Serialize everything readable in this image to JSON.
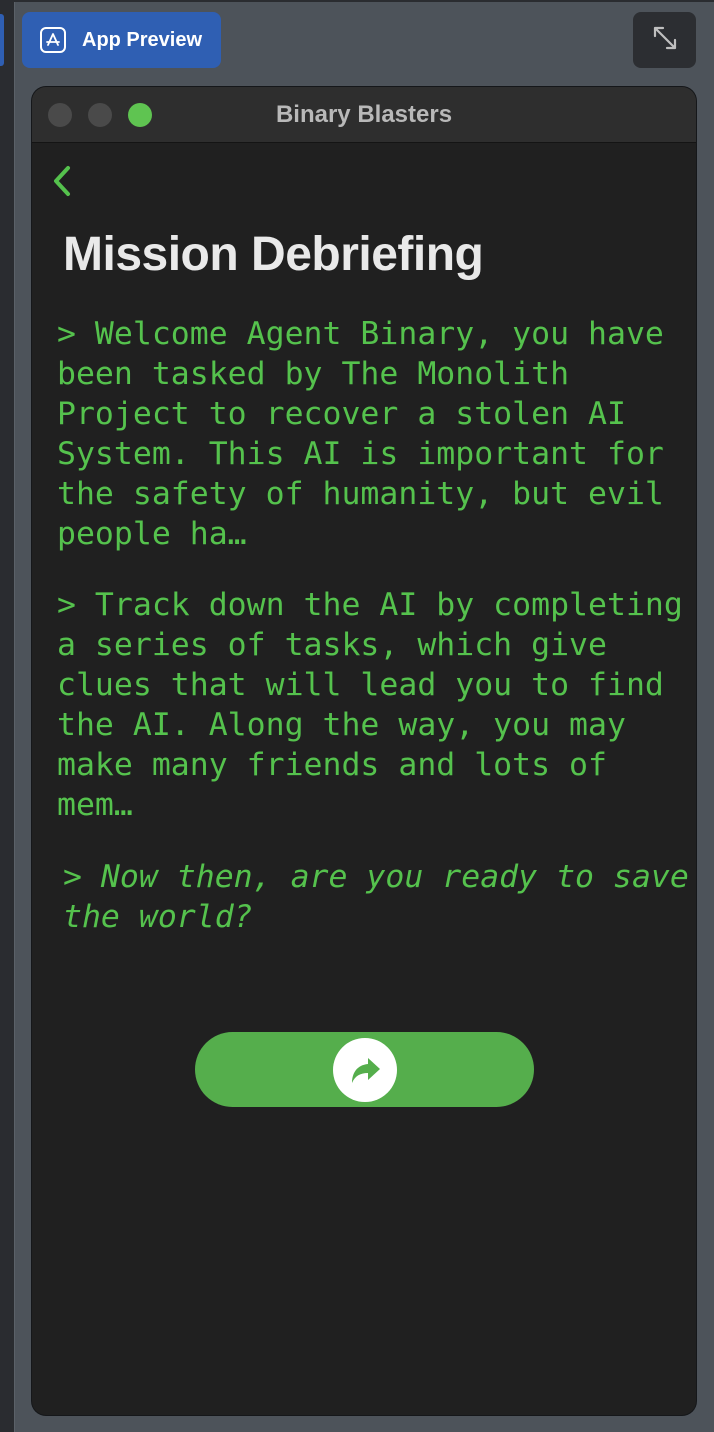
{
  "toolbar": {
    "app_preview_label": "App Preview",
    "app_preview_icon": "app-store-icon",
    "expand_icon": "expand-arrows-icon",
    "accent": "#2f5fb3"
  },
  "window": {
    "title": "Binary Blasters",
    "traffic_light_active": "#5fc451"
  },
  "screen": {
    "back_icon": "chevron-left-icon",
    "title": "Mission Debriefing",
    "paragraphs": [
      "> Welcome Agent Binary, you have been tasked by The Monolith Project to recover a stolen AI System. This AI is important for the safety of humanity, but evil people ha…",
      "> Track down the AI by completing a series of tasks, which give clues that will lead you to find the AI. Along the way, you may make many friends and lots of mem…",
      "> Now then, are you ready to save the world?"
    ],
    "continue_icon": "share-arrow-icon",
    "text_color": "#55c24d",
    "button_color": "#55ae4c",
    "background": "#202020"
  }
}
